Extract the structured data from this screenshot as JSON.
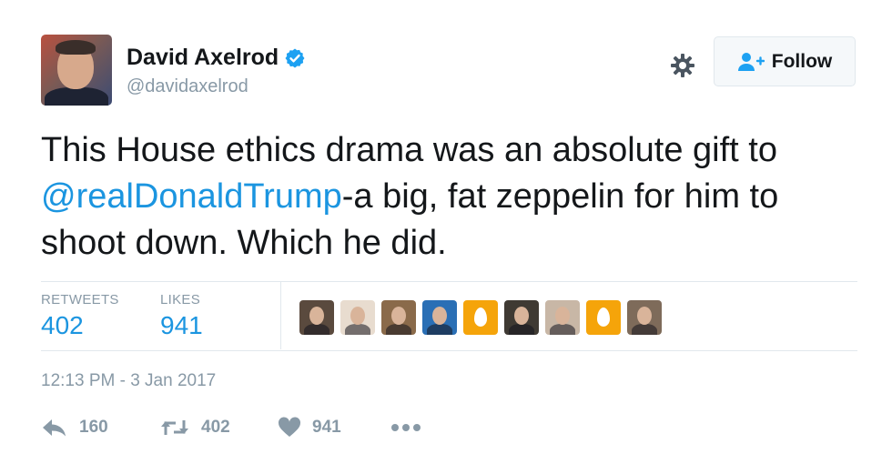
{
  "author": {
    "name": "David Axelrod",
    "handle": "@davidaxelrod",
    "verified_icon": "verified-badge-icon"
  },
  "header": {
    "follow_label": "Follow",
    "gear_icon": "gear-icon",
    "follow_icon": "add-user-icon"
  },
  "tweet": {
    "text_before": "This House ethics drama was an absolute gift to ",
    "mention": "@realDonaldTrump",
    "text_after": "-a big, fat zeppelin for him to shoot down. Which he did."
  },
  "stats": {
    "retweets_label": "RETWEETS",
    "retweets_value": "402",
    "likes_label": "LIKES",
    "likes_value": "941"
  },
  "likers": [
    {
      "kind": "photo",
      "color": "#5a4a3e"
    },
    {
      "kind": "photo",
      "color": "#e8dccf"
    },
    {
      "kind": "photo",
      "color": "#8a6a4a"
    },
    {
      "kind": "photo",
      "color": "#2a6fb5"
    },
    {
      "kind": "egg",
      "color": "#f5a40a"
    },
    {
      "kind": "photo",
      "color": "#3f3a33"
    },
    {
      "kind": "photo",
      "color": "#c8b7a6"
    },
    {
      "kind": "egg",
      "color": "#f5a40a"
    },
    {
      "kind": "photo",
      "color": "#7e6b5a"
    }
  ],
  "timestamp": "12:13 PM - 3 Jan 2017",
  "actions": {
    "reply_count": "160",
    "retweet_count": "402",
    "like_count": "941",
    "reply_icon": "reply-icon",
    "retweet_icon": "retweet-icon",
    "like_icon": "heart-icon",
    "more_icon": "more-icon"
  },
  "colors": {
    "accent": "#1b95e0",
    "muted": "#8899a6",
    "text": "#14171a",
    "border": "#e1e8ed"
  }
}
